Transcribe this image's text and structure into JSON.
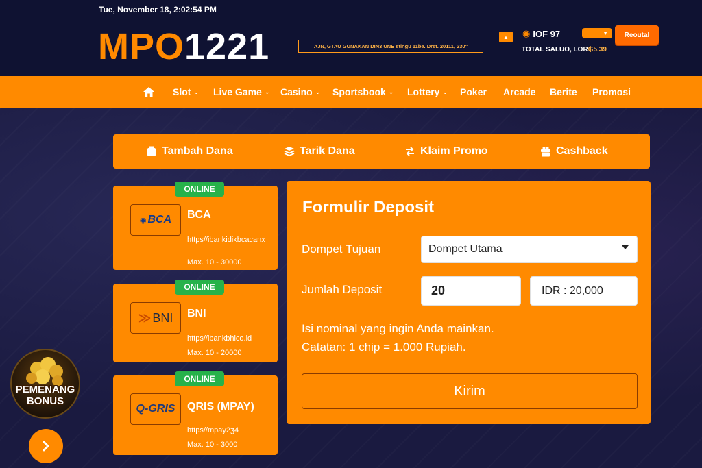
{
  "header": {
    "datetime": "Tue, November 18, 2:02:54 PM",
    "logo_part1": "MPO",
    "logo_part2": "1221",
    "marquee": "AJN, GTAU GUNAKAN DIN3 UNE stingu 11be. Drst. 20111, 230\"",
    "credit": "IOF 97",
    "total_label": "TOTAL SALUO, LOR",
    "total_amount": "₲5.39",
    "logout_label": "Reoutal"
  },
  "nav": {
    "items": [
      {
        "label": "Slot",
        "dropdown": true
      },
      {
        "label": "Live Game",
        "dropdown": true
      },
      {
        "label": "Casino",
        "dropdown": true
      },
      {
        "label": "Sportsbook",
        "dropdown": true
      },
      {
        "label": "Lottery",
        "dropdown": true
      },
      {
        "label": "Poker",
        "dropdown": false
      },
      {
        "label": "Arcade",
        "dropdown": false
      },
      {
        "label": "Berite",
        "dropdown": false
      },
      {
        "label": "Promosi",
        "dropdown": false
      }
    ]
  },
  "actions": {
    "deposit": "Tambah Dana",
    "withdraw": "Tarik Dana",
    "promo": "Klaim Promo",
    "cashback": "Cashback"
  },
  "banks": [
    {
      "status": "ONLINE",
      "logo": "BCA",
      "name": "BCA",
      "url": "https//ibankidikbcacanx",
      "max": "Max. 10 - 30000"
    },
    {
      "status": "ONLINE",
      "logo": "BNI",
      "name": "BNI",
      "url": "https//ibankbhico.id",
      "max": "Max. 10 - 20000"
    },
    {
      "status": "ONLINE",
      "logo": "Q-GRIS",
      "name": "QRIS (MPAY)",
      "url": "https//mpay2ʒ4",
      "max": "Max. 10 - 3000"
    }
  ],
  "form": {
    "title": "Formulir Deposit",
    "wallet_label": "Dompet Tujuan",
    "wallet_value": "Dompet Utama",
    "amount_label": "Jumlah Deposit",
    "amount_value": "20",
    "idr_value": "IDR : 20,000",
    "note1": "Isi nominal yang ingin Anda mainkan.",
    "note2": "Catatan: 1 chip = 1.000 Rupiah.",
    "submit": "Kirim"
  },
  "winner": {
    "line1": "PEMENANG",
    "line2": "BONUS"
  },
  "colors": {
    "accent": "#ff8a00",
    "header_bg": "#0f1232",
    "online": "#27b24a"
  }
}
